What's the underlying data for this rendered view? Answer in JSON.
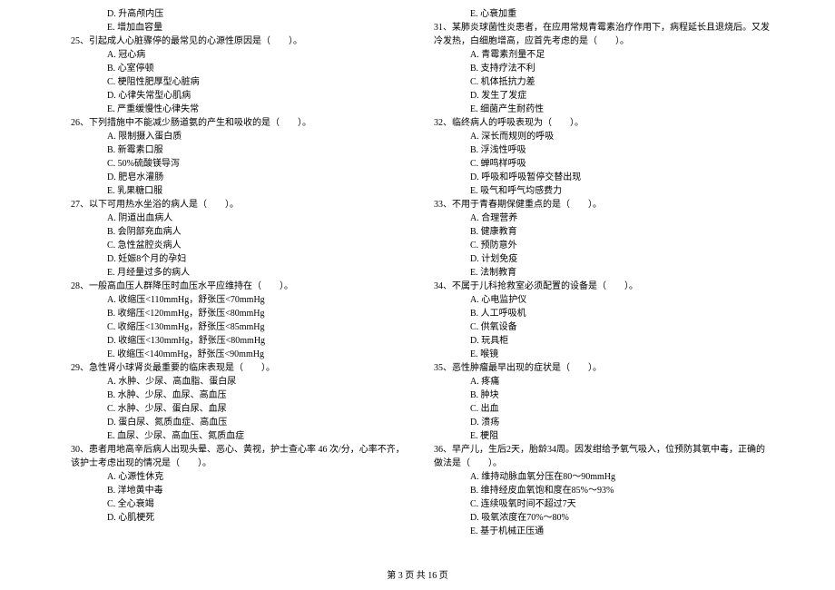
{
  "left_column": {
    "pre_options": [
      "D. 升高颅内压",
      "E. 增加血容量"
    ],
    "questions": [
      {
        "num": "25",
        "text": "引起成人心脏骤停的最常见的心源性原因是（　　）。",
        "options": [
          "A. 冠心病",
          "B. 心室停顿",
          "C. 梗阻性肥厚型心脏病",
          "D. 心律失常型心肌病",
          "E. 严重缓慢性心律失常"
        ]
      },
      {
        "num": "26",
        "text": "下列措施中不能减少肠道氨的产生和吸收的是（　　）。",
        "options": [
          "A. 限制摄入蛋白质",
          "B. 新霉素口服",
          "C. 50%硫酸镁导泻",
          "D. 肥皂水灌肠",
          "E. 乳果糖口服"
        ]
      },
      {
        "num": "27",
        "text": "以下可用热水坐浴的病人是（　　）。",
        "options": [
          "A. 阴道出血病人",
          "B. 会阴部充血病人",
          "C. 急性盆腔炎病人",
          "D. 妊娠8个月的孕妇",
          "E. 月经量过多的病人"
        ]
      },
      {
        "num": "28",
        "text": "一般高血压人群降压时血压水平应维持在（　　）。",
        "options": [
          "A. 收缩压<110mmHg，舒张压<70mmHg",
          "B. 收缩压<120mmHg，舒张压<80mmHg",
          "C. 收缩压<130mmHg，舒张压<85mmHg",
          "D. 收缩压<130mmHg，舒张压<80mmHg",
          "E. 收缩压<140mmHg，舒张压<90mmHg"
        ]
      },
      {
        "num": "29",
        "text": "急性肾小球肾炎最重要的临床表现是（　　）。",
        "options": [
          "A. 水肿、少尿、高血脂、蛋白尿",
          "B. 水肿、少尿、血尿、高血压",
          "C. 水肿、少尿、蛋白尿、血尿",
          "D. 蛋白尿、氮质血症、高血压",
          "E. 血尿、少尿、高血压、氮质血症"
        ]
      },
      {
        "num": "30",
        "text": "患者用地高辛后病人出现头晕、恶心、黄视，护士查心率 46 次/分，心率不齐，该护士考虑出现的情况是（　　）。",
        "options": [
          "A. 心源性休克",
          "B. 洋地黄中毒",
          "C. 全心衰竭",
          "D. 心肌梗死"
        ]
      }
    ]
  },
  "right_column": {
    "pre_options": [
      "E. 心衰加重"
    ],
    "questions": [
      {
        "num": "31",
        "text": "某肺炎球菌性炎患者，在应用常规青霉素治疗作用下，病程延长且退烧后。又发冷发热，白细胞增高，应首先考虑的是（　　）。",
        "options": [
          "A. 青霉素剂量不足",
          "B. 支持疗法不利",
          "C. 机体抵抗力差",
          "D. 发生了发症",
          "E. 细菌产生耐药性"
        ]
      },
      {
        "num": "32",
        "text": "临终病人的呼吸表现为（　　）。",
        "options": [
          "A. 深长而规则的呼吸",
          "B. 浮浅性呼吸",
          "C. 蝉鸣样呼吸",
          "D. 呼吸和呼吸暂停交替出现",
          "E. 吸气和呼气均感费力"
        ]
      },
      {
        "num": "33",
        "text": "不用于青春期保健重点的是（　　）。",
        "options": [
          "A. 合理营养",
          "B. 健康教育",
          "C. 预防意外",
          "D. 计划免疫",
          "E. 法制教育"
        ]
      },
      {
        "num": "34",
        "text": "不属于儿科抢救室必须配置的设备是（　　）。",
        "options": [
          "A. 心电监护仪",
          "B. 人工呼吸机",
          "C. 供氧设备",
          "D. 玩具柜",
          "E. 喉镜"
        ]
      },
      {
        "num": "35",
        "text": "恶性肿瘤最早出现的症状是（　　）。",
        "options": [
          "A. 疼痛",
          "B. 肿块",
          "C. 出血",
          "D. 溃疡",
          "E. 梗阻"
        ]
      },
      {
        "num": "36",
        "text": "早产儿，生后2天，胎龄34周。因发绀给予氧气吸入，位预防其氧中毒，正确的做法是（　　）。",
        "options": [
          "A. 维持动脉血氧分压在80～90mmHg",
          "B. 维持经皮血氧饱和度在85%～93%",
          "C. 连续吸氧时间不超过7天",
          "D. 吸氧浓度在70%～80%",
          "E. 基于机械正压通"
        ]
      }
    ]
  },
  "footer": "第 3 页 共 16 页"
}
